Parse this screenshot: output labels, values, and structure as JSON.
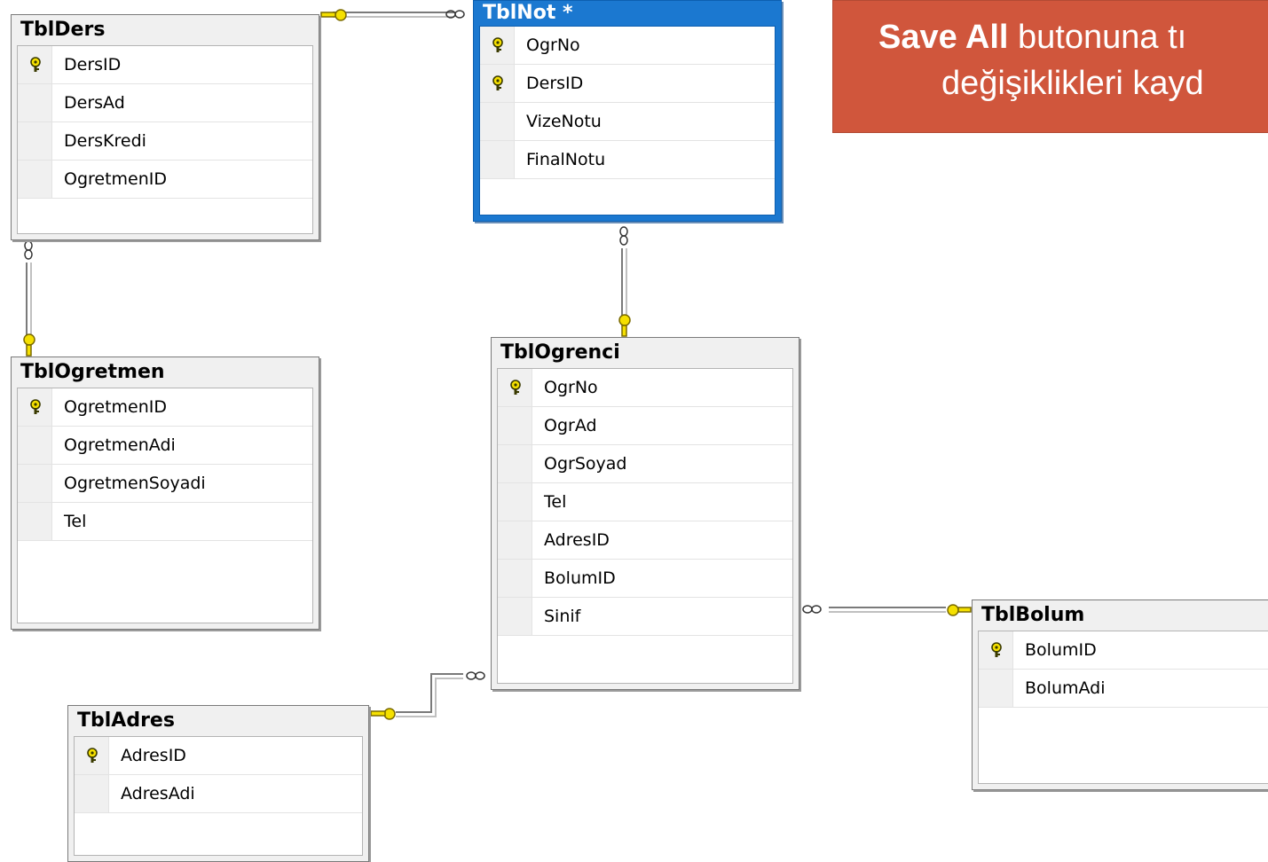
{
  "callout": {
    "bold": "Save All",
    "line1_rest": " butonuna tı",
    "line2": "değişiklikleri kayd"
  },
  "tables": {
    "ders": {
      "name": "TblDers",
      "columns": [
        "DersID",
        "DersAd",
        "DersKredi",
        "OgretmenID"
      ],
      "keys": [
        true,
        false,
        false,
        false
      ]
    },
    "not": {
      "name": "TblNot *",
      "columns": [
        "OgrNo",
        "DersID",
        "VizeNotu",
        "FinalNotu"
      ],
      "keys": [
        true,
        true,
        false,
        false
      ]
    },
    "ogretmen": {
      "name": "TblOgretmen",
      "columns": [
        "OgretmenID",
        "OgretmenAdi",
        "OgretmenSoyadi",
        "Tel"
      ],
      "keys": [
        true,
        false,
        false,
        false
      ]
    },
    "ogrenci": {
      "name": "TblOgrenci",
      "columns": [
        "OgrNo",
        "OgrAd",
        "OgrSoyad",
        "Tel",
        "AdresID",
        "BolumID",
        "Sinif"
      ],
      "keys": [
        true,
        false,
        false,
        false,
        false,
        false,
        false
      ]
    },
    "bolum": {
      "name": "TblBolum",
      "columns": [
        "BolumID",
        "BolumAdi"
      ],
      "keys": [
        true,
        false
      ]
    },
    "adres": {
      "name": "TblAdres",
      "columns": [
        "AdresID",
        "AdresAdi"
      ],
      "keys": [
        true,
        false
      ]
    }
  },
  "colors": {
    "callout": "#d0563c",
    "selected_title": "#1b78d0",
    "key_yellow": "#f5e000"
  }
}
